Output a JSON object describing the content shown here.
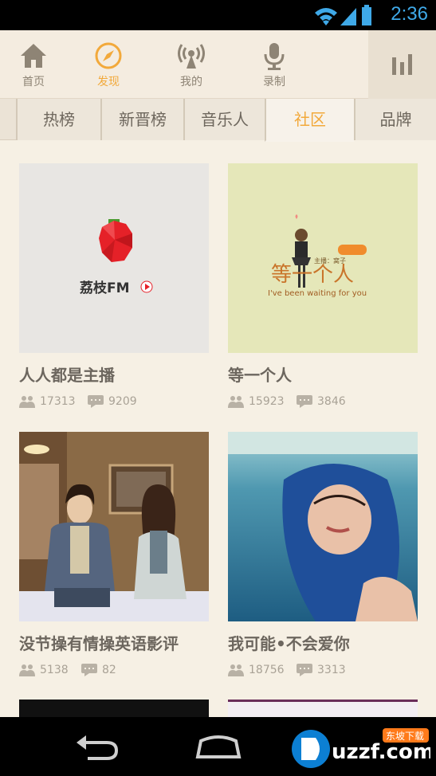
{
  "status": {
    "time": "2:36"
  },
  "nav": {
    "items": [
      {
        "label": "首页",
        "icon": "home-icon"
      },
      {
        "label": "发现",
        "icon": "compass-icon"
      },
      {
        "label": "我的",
        "icon": "broadcast-icon"
      },
      {
        "label": "录制",
        "icon": "microphone-icon"
      }
    ],
    "active_index": 1,
    "menu_icon": "bars-icon"
  },
  "tabs": [
    "热榜",
    "新晋榜",
    "音乐人",
    "社区",
    "品牌"
  ],
  "active_tab": "社区",
  "cards": [
    {
      "title": "人人都是主播",
      "members": "17313",
      "comments": "9209",
      "image_text": "荔枝FM"
    },
    {
      "title": "等一个人",
      "members": "15923",
      "comments": "3846",
      "image_text": "等一个人",
      "image_sub": "I've been waiting for you",
      "image_badge": "主播：窝子"
    },
    {
      "title": "没节操有情操英语影评",
      "members": "5138",
      "comments": "82"
    },
    {
      "title": "我可能•不会爱你",
      "members": "18756",
      "comments": "3313"
    }
  ],
  "colors": {
    "accent": "#f2a93b",
    "status_time": "#3fa9e8",
    "background": "#f6f0e4"
  },
  "watermark": "uzzf.com 东坡下载"
}
